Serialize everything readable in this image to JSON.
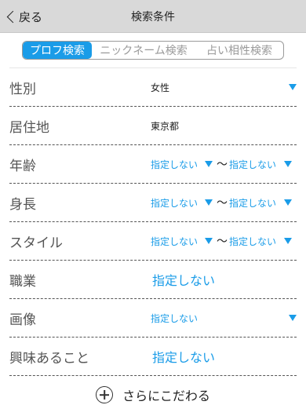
{
  "header": {
    "back_label": "戻る",
    "title": "検索条件"
  },
  "tabs": [
    {
      "label": "プロフ検索",
      "active": true
    },
    {
      "label": "ニックネーム検索",
      "active": false
    },
    {
      "label": "占い相性検索",
      "active": false
    }
  ],
  "fields": {
    "gender": {
      "label": "性別",
      "value": "女性"
    },
    "residence": {
      "label": "居住地",
      "value": "東京都"
    },
    "age": {
      "label": "年齢",
      "from": "指定しない",
      "separator": "〜",
      "to": "指定しない"
    },
    "height": {
      "label": "身長",
      "from": "指定しない",
      "separator": "〜",
      "to": "指定しない"
    },
    "style": {
      "label": "スタイル",
      "from": "指定しない",
      "separator": "〜",
      "to": "指定しない"
    },
    "occupation": {
      "label": "職業",
      "value": "指定しない"
    },
    "image": {
      "label": "画像",
      "value": "指定しない"
    },
    "interests": {
      "label": "興味あること",
      "value": "指定しない"
    }
  },
  "more": {
    "label": "さらにこだわる"
  },
  "colors": {
    "accent": "#1a9ce8",
    "header_bg": "#d9d9d9",
    "divider": "#555555"
  }
}
